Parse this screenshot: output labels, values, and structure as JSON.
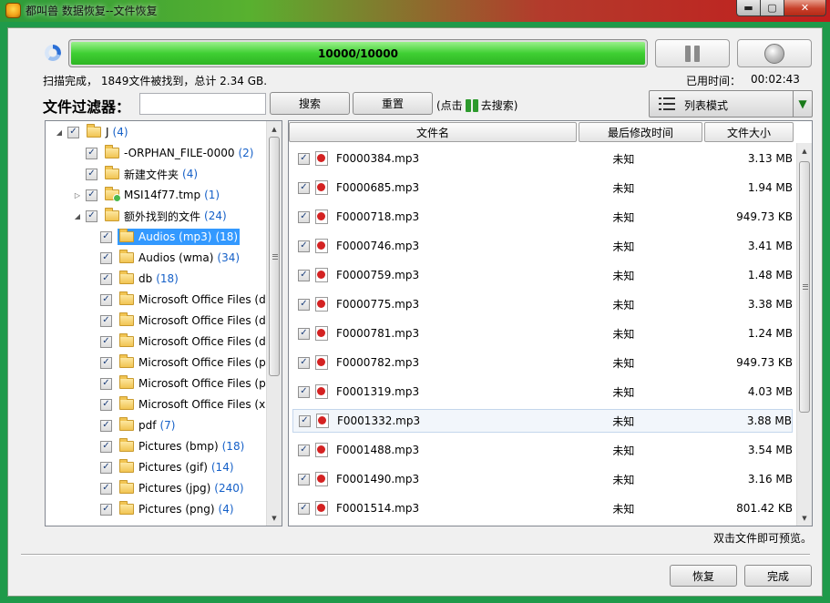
{
  "window": {
    "title": "都叫兽 数据恢复--文件恢复",
    "min_glyph": "▬",
    "max_glyph": "▢",
    "close_glyph": "✕"
  },
  "progress": {
    "text": "10000/10000",
    "fraction": 1.0,
    "color": "#3fcf33"
  },
  "status": {
    "summary": "扫描完成， 1849文件被找到，总计 2.34 GB.",
    "elapsed_label": "已用时间：",
    "elapsed_value": "00:02:43"
  },
  "filter": {
    "label": "文件过滤器：",
    "input_value": "",
    "search_label": "搜索",
    "reset_label": "重置",
    "hint_prefix": "(点击",
    "hint_suffix": "去搜索)"
  },
  "view_mode": {
    "label": "列表模式",
    "dropdown_glyph": "▼"
  },
  "tree": {
    "items": [
      {
        "label": "J",
        "count": "(4)",
        "level": 0,
        "expander": "◢",
        "checked": true,
        "selected": false,
        "badge": false
      },
      {
        "label": "-ORPHAN_FILE-0000",
        "count": "(2)",
        "level": 1,
        "expander": "",
        "checked": true,
        "selected": false,
        "badge": false
      },
      {
        "label": "新建文件夹",
        "count": "(4)",
        "level": 1,
        "expander": "",
        "checked": true,
        "selected": false,
        "badge": false
      },
      {
        "label": "MSI14f77.tmp",
        "count": "(1)",
        "level": 1,
        "expander": "▷",
        "checked": true,
        "selected": false,
        "badge": true
      },
      {
        "label": "额外找到的文件",
        "count": "(24)",
        "level": 1,
        "expander": "◢",
        "checked": true,
        "selected": false,
        "badge": false
      },
      {
        "label": "Audios (mp3)",
        "count": "(18)",
        "level": 2,
        "expander": "",
        "checked": true,
        "selected": true,
        "badge": false
      },
      {
        "label": "Audios (wma)",
        "count": "(34)",
        "level": 2,
        "expander": "",
        "checked": true,
        "selected": false,
        "badge": false
      },
      {
        "label": "db",
        "count": "(18)",
        "level": 2,
        "expander": "",
        "checked": true,
        "selected": false,
        "badge": false
      },
      {
        "label": "Microsoft Office Files (d",
        "count": "",
        "level": 2,
        "expander": "",
        "checked": true,
        "selected": false,
        "badge": false
      },
      {
        "label": "Microsoft Office Files (d",
        "count": "",
        "level": 2,
        "expander": "",
        "checked": true,
        "selected": false,
        "badge": false
      },
      {
        "label": "Microsoft Office Files (d",
        "count": "",
        "level": 2,
        "expander": "",
        "checked": true,
        "selected": false,
        "badge": false
      },
      {
        "label": "Microsoft Office Files (p",
        "count": "",
        "level": 2,
        "expander": "",
        "checked": true,
        "selected": false,
        "badge": false
      },
      {
        "label": "Microsoft Office Files (p",
        "count": "",
        "level": 2,
        "expander": "",
        "checked": true,
        "selected": false,
        "badge": false
      },
      {
        "label": "Microsoft Office Files (xl",
        "count": "",
        "level": 2,
        "expander": "",
        "checked": true,
        "selected": false,
        "badge": false
      },
      {
        "label": "pdf",
        "count": "(7)",
        "level": 2,
        "expander": "",
        "checked": true,
        "selected": false,
        "badge": false
      },
      {
        "label": "Pictures (bmp)",
        "count": "(18)",
        "level": 2,
        "expander": "",
        "checked": true,
        "selected": false,
        "badge": false
      },
      {
        "label": "Pictures (gif)",
        "count": "(14)",
        "level": 2,
        "expander": "",
        "checked": true,
        "selected": false,
        "badge": false
      },
      {
        "label": "Pictures (jpg)",
        "count": "(240)",
        "level": 2,
        "expander": "",
        "checked": true,
        "selected": false,
        "badge": false
      },
      {
        "label": "Pictures (png)",
        "count": "(4)",
        "level": 2,
        "expander": "",
        "checked": true,
        "selected": false,
        "badge": false
      }
    ]
  },
  "file_list": {
    "columns": [
      "文件名",
      "最后修改时间",
      "文件大小"
    ],
    "rows": [
      {
        "name": "F0000384.mp3",
        "modified": "未知",
        "size": "3.13 MB",
        "checked": true
      },
      {
        "name": "F0000685.mp3",
        "modified": "未知",
        "size": "1.94 MB",
        "checked": true
      },
      {
        "name": "F0000718.mp3",
        "modified": "未知",
        "size": "949.73 KB",
        "checked": true
      },
      {
        "name": "F0000746.mp3",
        "modified": "未知",
        "size": "3.41 MB",
        "checked": true
      },
      {
        "name": "F0000759.mp3",
        "modified": "未知",
        "size": "1.48 MB",
        "checked": true
      },
      {
        "name": "F0000775.mp3",
        "modified": "未知",
        "size": "3.38 MB",
        "checked": true
      },
      {
        "name": "F0000781.mp3",
        "modified": "未知",
        "size": "1.24 MB",
        "checked": true
      },
      {
        "name": "F0000782.mp3",
        "modified": "未知",
        "size": "949.73 KB",
        "checked": true
      },
      {
        "name": "F0001319.mp3",
        "modified": "未知",
        "size": "4.03 MB",
        "checked": true
      },
      {
        "name": "F0001332.mp3",
        "modified": "未知",
        "size": "3.88 MB",
        "checked": true
      },
      {
        "name": "F0001488.mp3",
        "modified": "未知",
        "size": "3.54 MB",
        "checked": true
      },
      {
        "name": "F0001490.mp3",
        "modified": "未知",
        "size": "3.16 MB",
        "checked": true
      },
      {
        "name": "F0001514.mp3",
        "modified": "未知",
        "size": "801.42 KB",
        "checked": true
      }
    ],
    "highlighted_index": 9
  },
  "footer": {
    "note": "双击文件即可预览。",
    "recover_label": "恢复",
    "done_label": "完成"
  },
  "check_glyph": "✓",
  "scroll": {
    "up_glyph": "▲",
    "down_glyph": "▼"
  }
}
